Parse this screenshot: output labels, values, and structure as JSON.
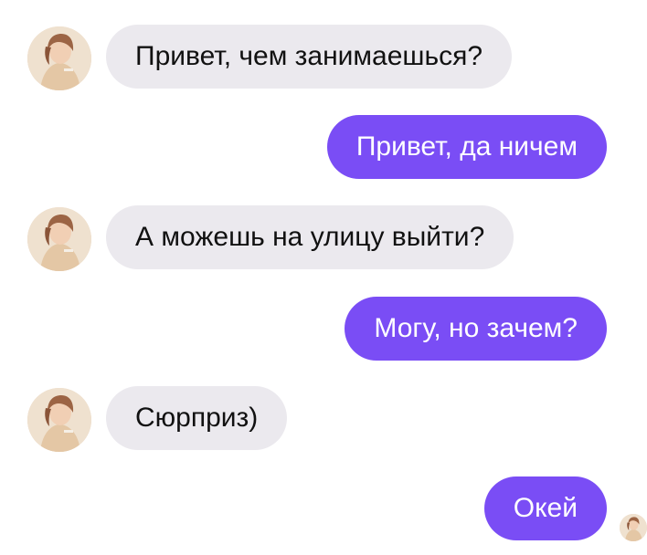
{
  "conversation": {
    "messages": [
      {
        "side": "in",
        "text": "Привет, чем занимаешься?"
      },
      {
        "side": "out",
        "text": "Привет, да ничем"
      },
      {
        "side": "in",
        "text": "А можешь на улицу выйти?"
      },
      {
        "side": "out",
        "text": "Могу, но зачем?"
      },
      {
        "side": "in",
        "text": "Сюрприз)"
      },
      {
        "side": "out",
        "text": "Окей"
      }
    ]
  },
  "colors": {
    "incoming_bubble": "#ebe9ee",
    "outgoing_bubble": "#7a4df5",
    "incoming_text": "#111111",
    "outgoing_text": "#ffffff"
  },
  "icons": {
    "contact_avatar": "contact-avatar-icon",
    "read_receipt_avatar": "read-receipt-avatar-icon"
  }
}
